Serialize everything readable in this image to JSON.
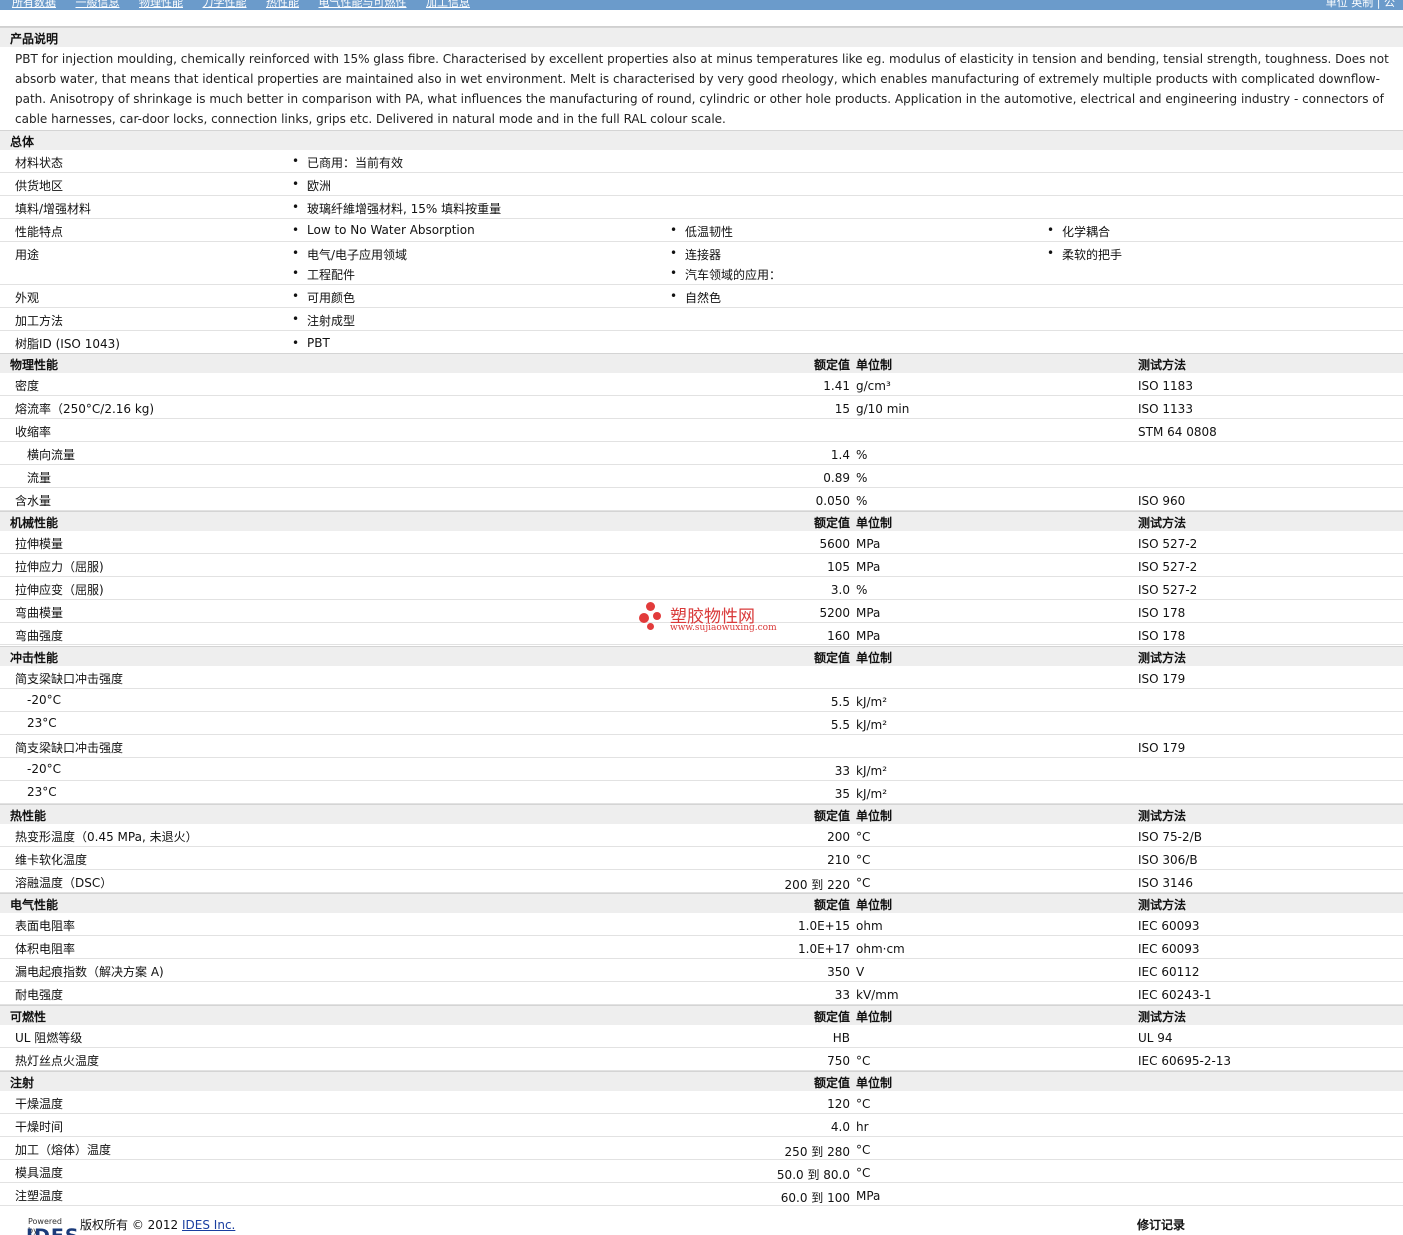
{
  "nav": {
    "items": [
      "所有数据",
      "一般信息",
      "物理性能",
      "力学性能",
      "热性能",
      "电气性能与可燃性",
      "加工信息"
    ],
    "right": "单位 英制 | 公"
  },
  "description": {
    "title": "产品说明",
    "text": "PBT for injection moulding, chemically reinforced with 15% glass fibre. Characterised by excellent properties also at minus temperatures like eg. modulus of elasticity in tension and bending, tensial strength, toughness. Does not absorb water, that means that identical properties are maintained also in wet environment. Melt is characterised by very good rheology, which enables manufacturing of extremely multiple products with complicated downflow-path. Anisotropy of shrinkage is much better in comparison with PA, what influences the manufacturing of round, cylindric or other hole products. Application in the automotive, electrical and engineering industry - connectors of cable harnesses, car-door locks, connection links, grips etc. Delivered in natural mode and in the full RAL colour scale."
  },
  "general": {
    "title": "总体",
    "rows": [
      {
        "label": "材料状态",
        "items": [
          "已商用：当前有效"
        ]
      },
      {
        "label": "供货地区",
        "items": [
          "欧洲"
        ]
      },
      {
        "label": "填料/增强材料",
        "items": [
          "玻璃纤維增强材料, 15% 填料按重量"
        ]
      },
      {
        "label": "性能特点",
        "items": [
          "Low to No Water Absorption",
          "低温韧性",
          "化学耦合"
        ]
      },
      {
        "label": "用途",
        "items": [
          "电气/电子应用领域",
          "连接器",
          "柔软的把手",
          "工程配件",
          "汽车领域的应用："
        ]
      },
      {
        "label": "外观",
        "items": [
          "可用颜色",
          "自然色"
        ]
      },
      {
        "label": "加工方法",
        "items": [
          "注射成型"
        ]
      },
      {
        "label": "树脂ID (ISO 1043)",
        "items": [
          "PBT"
        ]
      }
    ]
  },
  "columns": {
    "value": "额定值",
    "unit": "单位制",
    "test": "测试方法"
  },
  "physical": {
    "title": "物理性能",
    "rows": [
      {
        "label": "密度",
        "value": "1.41",
        "unit": "g/cm³",
        "test": "ISO 1183"
      },
      {
        "label": "熔流率（250°C/2.16 kg)",
        "value": "15",
        "unit": "g/10 min",
        "test": "ISO 1133"
      },
      {
        "label": "收缩率",
        "value": "",
        "unit": "",
        "test": "STM 64 0808"
      },
      {
        "label": "横向流量",
        "value": "1.4",
        "unit": "%",
        "test": ""
      },
      {
        "label": "流量",
        "value": "0.89",
        "unit": "%",
        "test": ""
      },
      {
        "label": "含水量",
        "value": "0.050",
        "unit": "%",
        "test": "ISO 960"
      }
    ]
  },
  "mechanical": {
    "title": "机械性能",
    "rows": [
      {
        "label": "拉伸模量",
        "value": "5600",
        "unit": "MPa",
        "test": "ISO 527-2"
      },
      {
        "label": "拉伸应力（屈服)",
        "value": "105",
        "unit": "MPa",
        "test": "ISO 527-2"
      },
      {
        "label": "拉伸应变（屈服)",
        "value": "3.0",
        "unit": "%",
        "test": "ISO 527-2"
      },
      {
        "label": "弯曲模量",
        "value": "5200",
        "unit": "MPa",
        "test": "ISO 178"
      },
      {
        "label": "弯曲强度",
        "value": "160",
        "unit": "MPa",
        "test": "ISO 178"
      }
    ]
  },
  "impact": {
    "title": "冲击性能",
    "rows": [
      {
        "label": "简支梁缺口冲击强度",
        "value": "",
        "unit": "",
        "test": "ISO 179"
      },
      {
        "label": "-20°C",
        "value": "5.5",
        "unit": "kJ/m²",
        "test": ""
      },
      {
        "label": "23°C",
        "value": "5.5",
        "unit": "kJ/m²",
        "test": ""
      },
      {
        "label": "简支梁缺口冲击强度",
        "value": "",
        "unit": "",
        "test": "ISO 179"
      },
      {
        "label": "-20°C",
        "value": "33",
        "unit": "kJ/m²",
        "test": ""
      },
      {
        "label": "23°C",
        "value": "35",
        "unit": "kJ/m²",
        "test": ""
      }
    ]
  },
  "thermal": {
    "title": "热性能",
    "rows": [
      {
        "label": "热变形温度（0.45 MPa, 未退火）",
        "value": "200",
        "unit": "°C",
        "test": "ISO 75-2/B"
      },
      {
        "label": "维卡软化温度",
        "value": "210",
        "unit": "°C",
        "test": "ISO 306/B"
      },
      {
        "label": "溶融温度（DSC）",
        "value": "200 到 220",
        "unit": "°C",
        "test": "ISO 3146"
      }
    ]
  },
  "electrical": {
    "title": "电气性能",
    "rows": [
      {
        "label": "表面电阻率",
        "value": "1.0E+15",
        "unit": "ohm",
        "test": "IEC 60093"
      },
      {
        "label": "体积电阻率",
        "value": "1.0E+17",
        "unit": "ohm·cm",
        "test": "IEC 60093"
      },
      {
        "label": "漏电起痕指数（解决方案 A)",
        "value": "350",
        "unit": "V",
        "test": "IEC 60112"
      },
      {
        "label": "耐电强度",
        "value": "33",
        "unit": "kV/mm",
        "test": "IEC 60243-1"
      }
    ]
  },
  "flammability": {
    "title": "可燃性",
    "rows": [
      {
        "label": "UL 阻燃等级",
        "value": "HB",
        "unit": "",
        "test": "UL 94"
      },
      {
        "label": "热灯丝点火温度",
        "value": "750",
        "unit": "°C",
        "test": "IEC 60695-2-13"
      }
    ]
  },
  "injection": {
    "title": "注射",
    "rows": [
      {
        "label": "干燥温度",
        "value": "120",
        "unit": "°C",
        "test": ""
      },
      {
        "label": "干燥时间",
        "value": "4.0",
        "unit": "hr",
        "test": ""
      },
      {
        "label": "加工（熔体）温度",
        "value": "250 到 280",
        "unit": "°C",
        "test": ""
      },
      {
        "label": "模具温度",
        "value": "50.0 到 80.0",
        "unit": "°C",
        "test": ""
      },
      {
        "label": "注塑温度",
        "value": "60.0 到 100",
        "unit": "MPa",
        "test": ""
      }
    ]
  },
  "watermark": {
    "title": "塑胶物性网",
    "url": "www.sujiaowuxing.com"
  },
  "footer": {
    "powered": "Powered by",
    "logo": "IDES",
    "copyright": "版权所有 © 2012",
    "company": "IDES Inc.",
    "revision": "修订记录"
  }
}
